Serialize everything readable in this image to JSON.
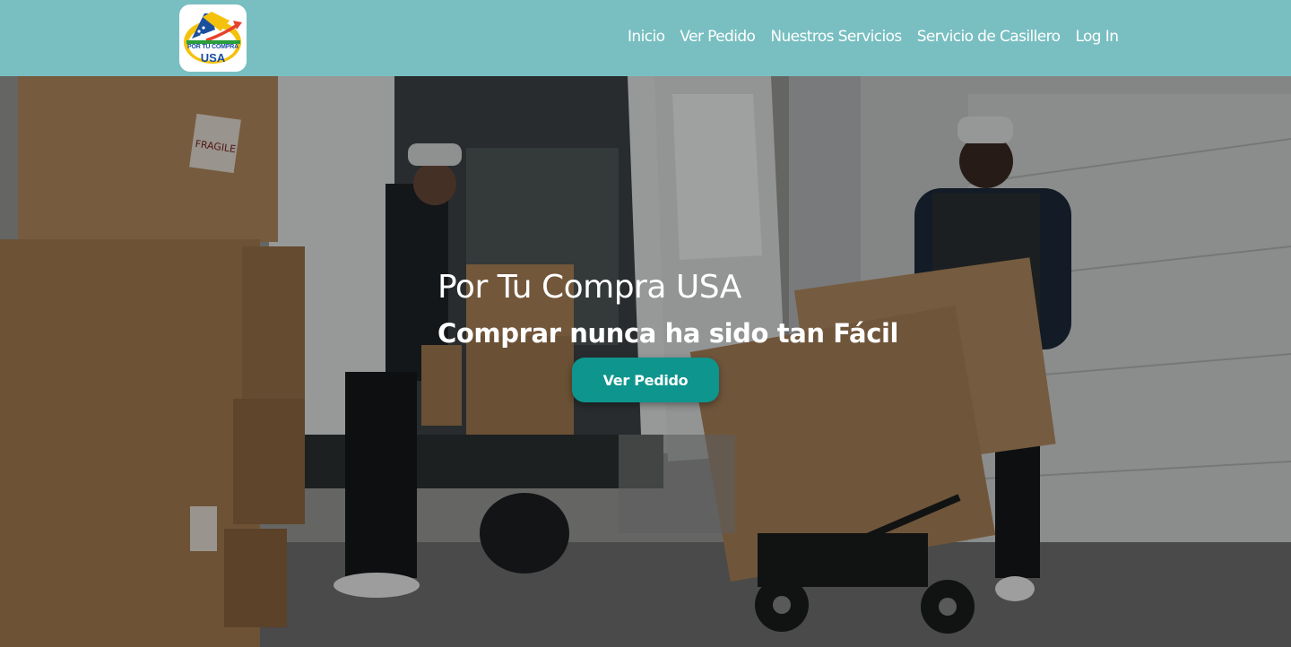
{
  "brand": {
    "logo_top_text": "POR TU COMPRA",
    "logo_bottom_text": "USA",
    "colors": {
      "navbar": "#79bfc1",
      "accent": "#0e958d",
      "logo_blue": "#1a4fa0",
      "logo_yellow": "#f4c20d"
    }
  },
  "nav": {
    "items": [
      {
        "label": "Inicio"
      },
      {
        "label": "Ver Pedido"
      },
      {
        "label": "Nuestros Servicios"
      },
      {
        "label": "Servicio de Casillero"
      },
      {
        "label": "Log In"
      }
    ]
  },
  "hero": {
    "title": "Por Tu Compra USA",
    "subtitle": "Comprar nunca ha sido tan Fácil",
    "button_label": "Ver Pedido"
  },
  "background": {
    "box_labels": [
      "FRAGILE",
      "FRAGILE"
    ]
  }
}
